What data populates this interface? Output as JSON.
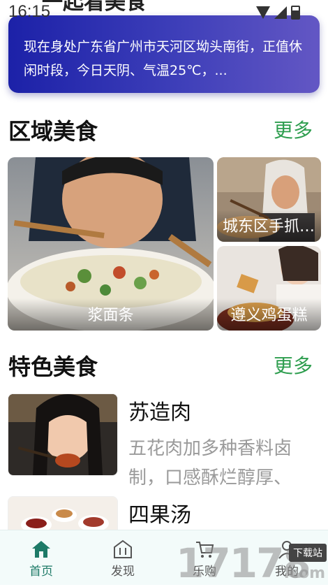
{
  "status": {
    "time": "16:15"
  },
  "header": {
    "peek_title": "一起看美食"
  },
  "banner": {
    "text": "现在身处广东省广州市天河区坳头南街，正值休闲时段，今日天阴、气温25℃，..."
  },
  "regional": {
    "title": "区域美食",
    "more": "更多",
    "cards": [
      {
        "label": "浆面条"
      },
      {
        "label": "城东区手抓羊肉"
      },
      {
        "label": "遵义鸡蛋糕"
      }
    ]
  },
  "featured": {
    "title": "特色美食",
    "more": "更多",
    "items": [
      {
        "title": "苏造肉",
        "desc": "五花肉加多种香料卤制，口感酥烂醇厚、"
      },
      {
        "title": "四果汤",
        "desc": ""
      }
    ]
  },
  "tabs": [
    {
      "label": "首页",
      "icon": "home-icon",
      "active": true
    },
    {
      "label": "发现",
      "icon": "discover-icon",
      "active": false
    },
    {
      "label": "乐购",
      "icon": "cart-icon",
      "active": false
    },
    {
      "label": "我的",
      "icon": "user-icon",
      "active": false
    }
  ],
  "watermark": {
    "number": "17178",
    "badge": "下载站",
    "domain": ".com"
  },
  "colors": {
    "accent": "#2e9e4f",
    "banner_start": "#1c21a8",
    "banner_end": "#6357c4",
    "tab_active": "#1d7a67"
  }
}
